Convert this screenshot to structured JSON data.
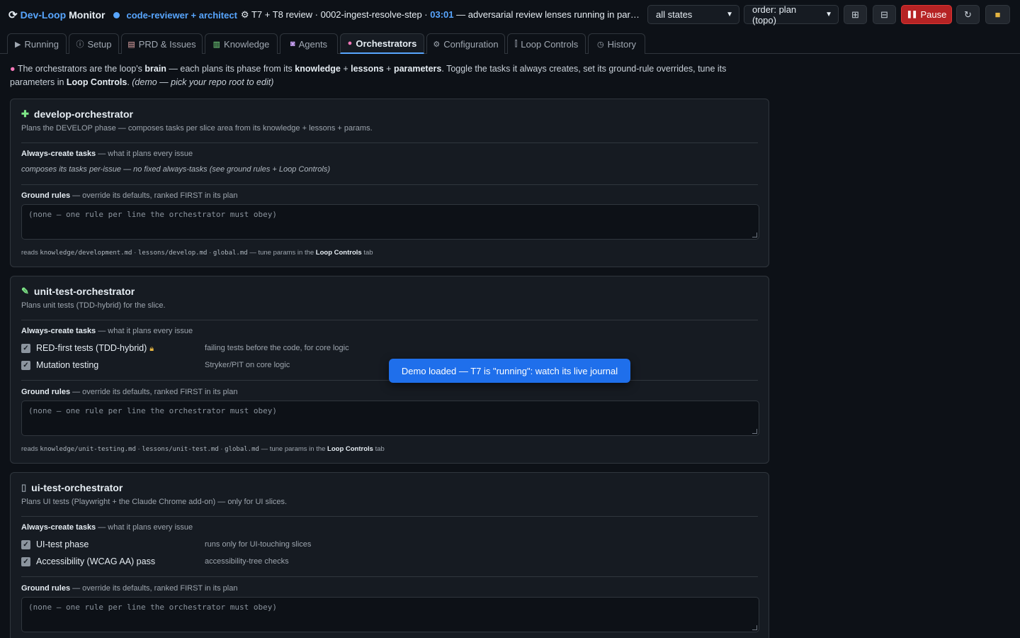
{
  "header": {
    "logo_icon": "refresh-loop-icon",
    "title_prefix": "Dev-Loop",
    "title_suffix": "Monitor",
    "status_dot_color": "#58a6ff",
    "agents": "code-reviewer + architect",
    "status_icon": "gear-icon",
    "status_text": "T7 + T8 review · 0002-ingest-resolve-step ·",
    "timer": "03:01",
    "status_tail": "— adversarial review lenses running in parallel on the ...",
    "filter_select": "all states",
    "order_select": "order: plan (topo)",
    "pause_label": "Pause"
  },
  "tabs": [
    {
      "label": "Running",
      "icon": "play-icon"
    },
    {
      "label": "Setup",
      "icon": "info-icon"
    },
    {
      "label": "PRD & Issues",
      "icon": "clipboard-icon"
    },
    {
      "label": "Knowledge",
      "icon": "books-icon"
    },
    {
      "label": "Agents",
      "icon": "robot-icon"
    },
    {
      "label": "Orchestrators",
      "icon": "brain-icon",
      "active": true
    },
    {
      "label": "Configuration",
      "icon": "gear-icon"
    },
    {
      "label": "Loop Controls",
      "icon": "slider-icon"
    },
    {
      "label": "History",
      "icon": "clock-icon"
    }
  ],
  "intro": {
    "icon": "brain-icon",
    "p1": "The orchestrators are the loop's ",
    "b1": "brain",
    "p2": " — each plans its phase from its ",
    "b2": "knowledge",
    "p3": " + ",
    "b3": "lessons",
    "p4": " + ",
    "b4": "parameters",
    "p5": ". Toggle the tasks it always creates, set its ground-rule overrides, tune its parameters in ",
    "b5": "Loop Controls",
    "p6": ". ",
    "demo": "(demo — pick your repo root to edit)"
  },
  "labels": {
    "always_create": "Always-create tasks",
    "always_create_hint": " — what it plans every issue",
    "ground_rules": "Ground rules",
    "ground_rules_hint": " — override its defaults, ranked FIRST in its plan",
    "ground_rules_placeholder": "(none — one rule per line the orchestrator must obey)",
    "reads_prefix": "reads ",
    "sep": " · ",
    "tune_prefix": " — tune params in the ",
    "tune_tab": "Loop Controls",
    "tune_suffix": " tab"
  },
  "orchestrators": [
    {
      "icon": "puzzle-icon",
      "name": "develop-orchestrator",
      "description": "Plans the DEVELOP phase — composes tasks per slice area from its knowledge + lessons + params.",
      "note": "composes its tasks per-issue — no fixed always-tasks (see ground rules + Loop Controls)",
      "tasks": [],
      "reads": [
        "knowledge/development.md",
        "lessons/develop.md",
        "global.md"
      ]
    },
    {
      "icon": "pencil-icon",
      "name": "unit-test-orchestrator",
      "description": "Plans unit tests (TDD-hybrid) for the slice.",
      "tasks": [
        {
          "label": "RED-first tests (TDD-hybrid)",
          "locked": true,
          "lock_icon": "lock-icon",
          "checked": true,
          "desc": "failing tests before the code, for core logic"
        },
        {
          "label": "Mutation testing",
          "locked": false,
          "checked": true,
          "desc": "Stryker/PIT on core logic"
        }
      ],
      "reads": [
        "knowledge/unit-testing.md",
        "lessons/unit-test.md",
        "global.md"
      ]
    },
    {
      "icon": "phone-icon",
      "name": "ui-test-orchestrator",
      "description": "Plans UI tests (Playwright + the Claude Chrome add-on) — only for UI slices.",
      "tasks": [
        {
          "label": "UI-test phase",
          "checked": true,
          "desc": "runs only for UI-touching slices"
        },
        {
          "label": "Accessibility (WCAG AA) pass",
          "checked": true,
          "desc": "accessibility-tree checks"
        }
      ]
    }
  ],
  "toast": "Demo loaded — T7 is \"running\": watch its live journal"
}
